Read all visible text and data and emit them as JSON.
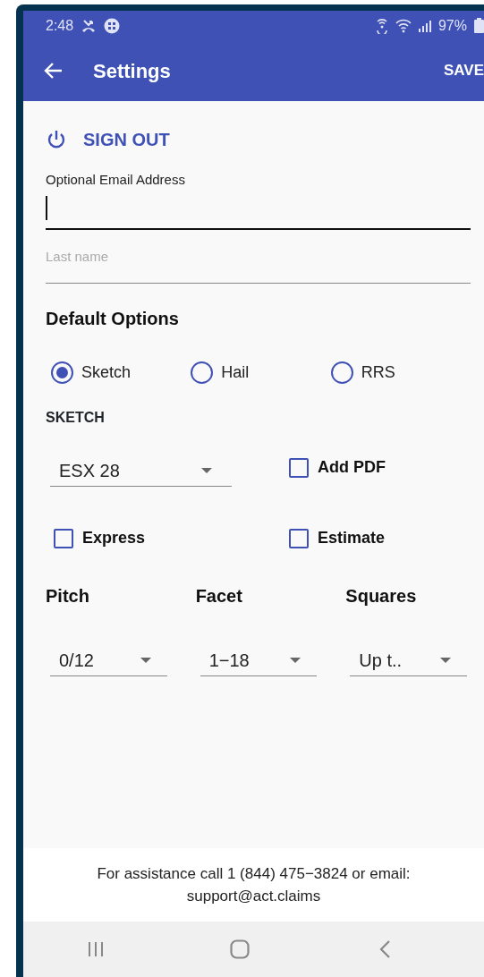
{
  "status_bar": {
    "time": "2:48",
    "battery": "97%"
  },
  "app_bar": {
    "title": "Settings",
    "action": "SAVE"
  },
  "sign_out": "SIGN OUT",
  "fields": [
    {
      "label": "Optional Email Address",
      "focused": true
    },
    {
      "placeholder": "Last name",
      "focused": false
    }
  ],
  "default_options": {
    "title": "Default Options",
    "radios": [
      {
        "label": "Sketch",
        "selected": true
      },
      {
        "label": "Hail",
        "selected": false
      },
      {
        "label": "RRS",
        "selected": false
      }
    ],
    "sketch_heading": "SKETCH",
    "sketch_dropdown": "ESX 28",
    "checkboxes": [
      {
        "label": "Add PDF",
        "checked": false
      },
      {
        "label": "Express",
        "checked": false
      },
      {
        "label": "Estimate",
        "checked": false
      }
    ],
    "selectors": [
      {
        "label": "Pitch",
        "value": "0/12"
      },
      {
        "label": "Facet",
        "value": "1−18"
      },
      {
        "label": "Squares",
        "value": "Up t.."
      }
    ]
  },
  "footer": "For assistance call 1 (844) 475−3824 or email: support@act.claims"
}
